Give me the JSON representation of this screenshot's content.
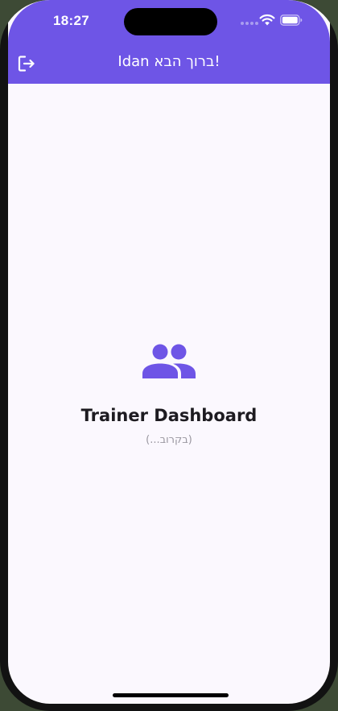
{
  "status_bar": {
    "time": "18:27"
  },
  "header": {
    "title": "!ברוך הבא Idan",
    "logout_icon": "logout-icon",
    "background_color": "#6e55e6"
  },
  "main": {
    "icon": "people-icon",
    "title": "Trainer Dashboard",
    "subtitle": "(בקרוב...)",
    "accent_color": "#6e55e6"
  }
}
